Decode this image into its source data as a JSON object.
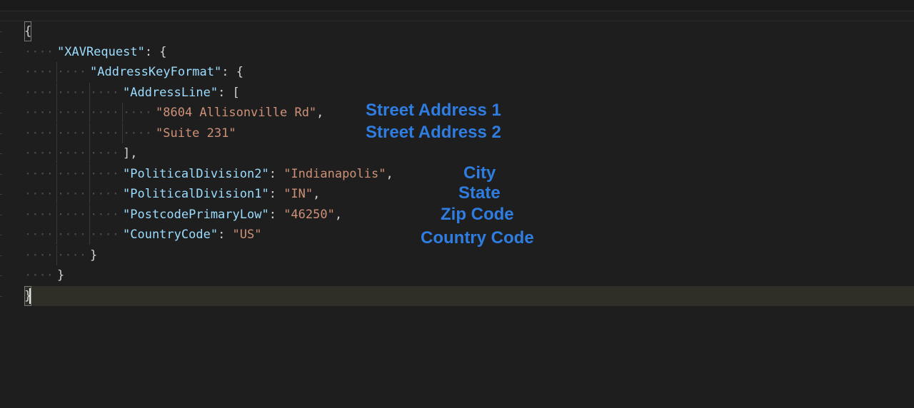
{
  "code": {
    "lines": [
      {
        "tokens": [
          {
            "t": "{",
            "c": "brace"
          }
        ]
      },
      {
        "tokens": [
          {
            "t": "\"XAVRequest\"",
            "c": "key"
          },
          {
            "t": ": {",
            "c": "punc"
          }
        ]
      },
      {
        "tokens": [
          {
            "t": "\"AddressKeyFormat\"",
            "c": "key"
          },
          {
            "t": ": {",
            "c": "punc"
          }
        ]
      },
      {
        "tokens": [
          {
            "t": "\"AddressLine\"",
            "c": "key"
          },
          {
            "t": ": [",
            "c": "punc"
          }
        ]
      },
      {
        "tokens": [
          {
            "t": "\"8604 Allisonville Rd\"",
            "c": "str"
          },
          {
            "t": ",",
            "c": "punc"
          }
        ]
      },
      {
        "tokens": [
          {
            "t": "\"Suite 231\"",
            "c": "str"
          }
        ]
      },
      {
        "tokens": [
          {
            "t": "],",
            "c": "punc"
          }
        ]
      },
      {
        "tokens": [
          {
            "t": "\"PoliticalDivision2\"",
            "c": "key"
          },
          {
            "t": ": ",
            "c": "punc"
          },
          {
            "t": "\"Indianapolis\"",
            "c": "str"
          },
          {
            "t": ",",
            "c": "punc"
          }
        ]
      },
      {
        "tokens": [
          {
            "t": "\"PoliticalDivision1\"",
            "c": "key"
          },
          {
            "t": ": ",
            "c": "punc"
          },
          {
            "t": "\"IN\"",
            "c": "str"
          },
          {
            "t": ",",
            "c": "punc"
          }
        ]
      },
      {
        "tokens": [
          {
            "t": "\"PostcodePrimaryLow\"",
            "c": "key"
          },
          {
            "t": ": ",
            "c": "punc"
          },
          {
            "t": "\"46250\"",
            "c": "str"
          },
          {
            "t": ",",
            "c": "punc"
          }
        ]
      },
      {
        "tokens": [
          {
            "t": "\"CountryCode\"",
            "c": "key"
          },
          {
            "t": ": ",
            "c": "punc"
          },
          {
            "t": "\"US\"",
            "c": "str"
          }
        ]
      },
      {
        "tokens": [
          {
            "t": "}",
            "c": "brace"
          }
        ]
      },
      {
        "tokens": [
          {
            "t": "}",
            "c": "brace"
          }
        ]
      },
      {
        "tokens": [
          {
            "t": "}",
            "c": "brace"
          }
        ]
      }
    ]
  },
  "annotations": {
    "street1": "Street Address 1",
    "street2": "Street Address 2",
    "city": "City",
    "state": "State",
    "zip": "Zip Code",
    "country": "Country Code"
  },
  "colors": {
    "background": "#1e1e1e",
    "json_key": "#9cdcfe",
    "json_string": "#ce9178",
    "annotation": "#2f7de1",
    "current_line": "#2f2f28"
  }
}
